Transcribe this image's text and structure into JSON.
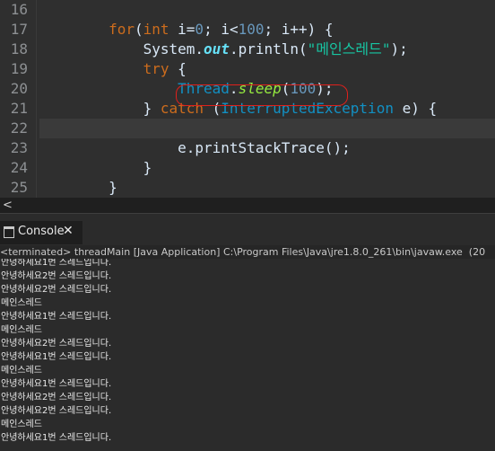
{
  "editor": {
    "line_numbers": [
      "16",
      "17",
      "18",
      "19",
      "20",
      "21",
      "22",
      "23",
      "24",
      "25"
    ],
    "lines": [
      [],
      [
        {
          "t": "        ",
          "c": "pl"
        },
        {
          "t": "for",
          "c": "kw"
        },
        {
          "t": "(",
          "c": "pl"
        },
        {
          "t": "int",
          "c": "kw"
        },
        {
          "t": " i=",
          "c": "pl"
        },
        {
          "t": "0",
          "c": "num"
        },
        {
          "t": "; i<",
          "c": "pl"
        },
        {
          "t": "100",
          "c": "num"
        },
        {
          "t": "; i++) {",
          "c": "pl"
        }
      ],
      [
        {
          "t": "            System.",
          "c": "pl"
        },
        {
          "t": "out",
          "c": "fld"
        },
        {
          "t": ".println(",
          "c": "pl"
        },
        {
          "t": "\"메인스레드\"",
          "c": "str"
        },
        {
          "t": ");",
          "c": "pl"
        }
      ],
      [
        {
          "t": "            ",
          "c": "pl"
        },
        {
          "t": "try",
          "c": "kw"
        },
        {
          "t": " {",
          "c": "pl"
        }
      ],
      [
        {
          "t": "                ",
          "c": "pl"
        },
        {
          "t": "Thread",
          "c": "typ"
        },
        {
          "t": ".",
          "c": "pl"
        },
        {
          "t": "sleep",
          "c": "sm"
        },
        {
          "t": "(",
          "c": "pl"
        },
        {
          "t": "100",
          "c": "num"
        },
        {
          "t": ");",
          "c": "pl"
        }
      ],
      [
        {
          "t": "            } ",
          "c": "pl"
        },
        {
          "t": "catch",
          "c": "kw"
        },
        {
          "t": " (",
          "c": "pl"
        },
        {
          "t": "InterruptedException",
          "c": "typ"
        },
        {
          "t": " e) {",
          "c": "pl"
        }
      ],
      [],
      [
        {
          "t": "                e.printStackTrace();",
          "c": "pl"
        }
      ],
      [
        {
          "t": "            }",
          "c": "pl"
        }
      ],
      [
        {
          "t": "        }",
          "c": "pl"
        }
      ]
    ],
    "current_line_index": 6
  },
  "scrollbar": {
    "left_arrow": "<"
  },
  "console": {
    "tab_title": "Console",
    "close_glyph": "✕",
    "header": "<terminated> threadMain [Java Application] C:\\Program Files\\Java\\jre1.8.0_261\\bin\\javaw.exe  (20",
    "output": [
      "안녕하세요1번 스레드입니다.",
      "안녕하세요2번 스레드입니다.",
      "안녕하세요2번 스레드입니다.",
      "메인스레드",
      "안녕하세요1번 스레드입니다.",
      "메인스레드",
      "안녕하세요2번 스레드입니다.",
      "안녕하세요1번 스레드입니다.",
      "메인스레드",
      "안녕하세요1번 스레드입니다.",
      "안녕하세요2번 스레드입니다.",
      "안녕하세요2번 스레드입니다.",
      "메인스레드",
      "안녕하세요1번 스레드입니다."
    ]
  }
}
